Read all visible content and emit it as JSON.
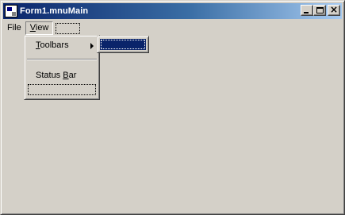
{
  "window": {
    "title": "Form1.mnuMain",
    "controls": {
      "minimize": "minimize",
      "maximize": "maximize",
      "close": "×"
    }
  },
  "menubar": {
    "items": [
      {
        "label": "File"
      },
      {
        "label_prefix": "",
        "label_mnemonic": "V",
        "label_rest": "iew"
      }
    ]
  },
  "view_menu": {
    "toolbars": {
      "mnemonic": "T",
      "rest": "oolbars"
    },
    "status_bar": {
      "prefix": "Status ",
      "mnemonic": "B",
      "rest": "ar"
    }
  },
  "colors": {
    "face": "#d4d0c8",
    "title_start": "#0a246a",
    "title_end": "#a6caf0",
    "highlight": "#0a246a"
  }
}
